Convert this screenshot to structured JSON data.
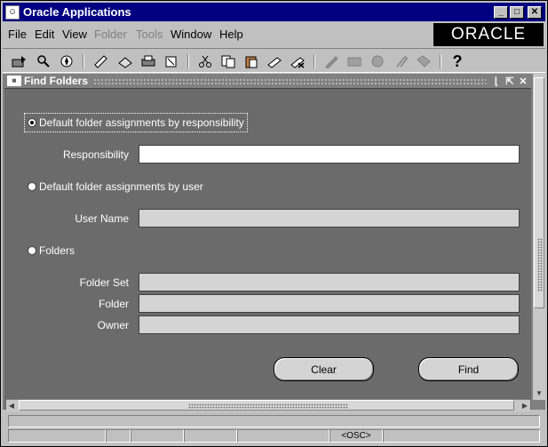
{
  "app": {
    "title": "Oracle Applications",
    "logo_text": "ORACLE"
  },
  "menu": {
    "items": [
      {
        "label": "File",
        "enabled": true
      },
      {
        "label": "Edit",
        "enabled": true
      },
      {
        "label": "View",
        "enabled": true
      },
      {
        "label": "Folder",
        "enabled": false
      },
      {
        "label": "Tools",
        "enabled": false
      },
      {
        "label": "Window",
        "enabled": true
      },
      {
        "label": "Help",
        "enabled": true
      }
    ]
  },
  "toolbar": {
    "icons": [
      "new-icon",
      "find-icon",
      "navigator-icon",
      "save-icon",
      "next-step-icon",
      "print-icon",
      "close-form-icon",
      "cut-icon",
      "copy-icon",
      "paste-icon",
      "new-record-icon",
      "delete-record-icon",
      "edit-field-icon",
      "zoom-icon",
      "translations-icon",
      "attachments-icon",
      "folder-tools-icon",
      "help-icon"
    ]
  },
  "child_window": {
    "title": "Find Folders"
  },
  "form": {
    "radio_responsibility": "Default folder assignments by responsibility",
    "label_responsibility": "Responsibility",
    "value_responsibility": "",
    "radio_user": "Default folder assignments by user",
    "label_user_name": "User Name",
    "value_user_name": "",
    "radio_folders": "Folders",
    "label_folder_set": "Folder Set",
    "label_folder": "Folder",
    "label_owner": "Owner",
    "value_folder_set": "",
    "value_folder": "",
    "value_owner": ""
  },
  "buttons": {
    "clear": "Clear",
    "find": "Find"
  },
  "status": {
    "message": "",
    "mode": "<OSC>"
  }
}
